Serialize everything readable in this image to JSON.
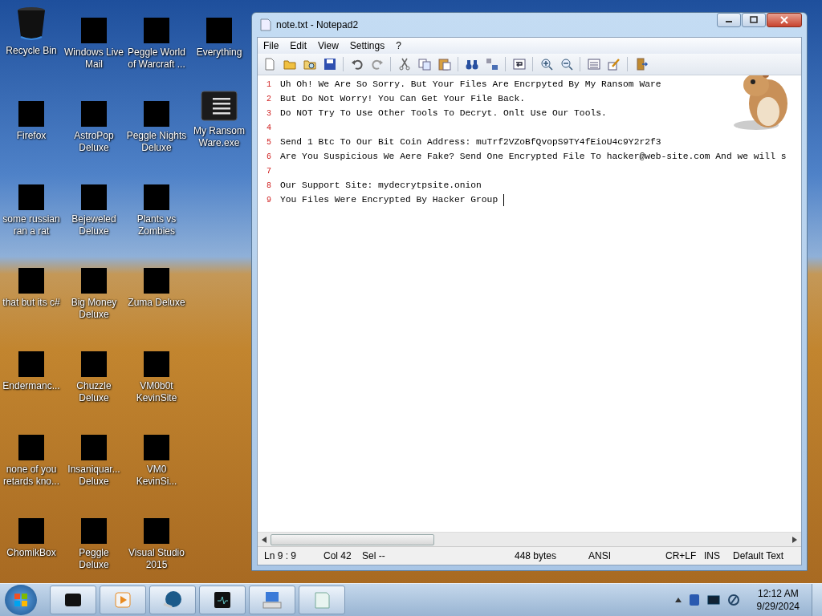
{
  "desktop_icons": [
    {
      "label": "Recycle Bin",
      "kind": "bin"
    },
    {
      "label": "Firefox",
      "kind": "redacted"
    },
    {
      "label": "some russian ran a rat",
      "kind": "redacted"
    },
    {
      "label": "that but its c#",
      "kind": "redacted"
    },
    {
      "label": "Endermanc...",
      "kind": "redacted"
    },
    {
      "label": "none of you retards kno...",
      "kind": "redacted"
    },
    {
      "label": "ChomikBox",
      "kind": "redacted"
    },
    {
      "label": "Windows Live Mail",
      "kind": "redacted"
    },
    {
      "label": "AstroPop Deluxe",
      "kind": "redacted"
    },
    {
      "label": "Bejeweled Deluxe",
      "kind": "redacted"
    },
    {
      "label": "Big Money Deluxe",
      "kind": "redacted"
    },
    {
      "label": "Chuzzle Deluxe",
      "kind": "redacted"
    },
    {
      "label": "Insaniquar... Deluxe",
      "kind": "redacted"
    },
    {
      "label": "Peggle Deluxe",
      "kind": "redacted"
    },
    {
      "label": "Peggle World of Warcraft ...",
      "kind": "redacted"
    },
    {
      "label": "Peggle Nights Deluxe",
      "kind": "redacted"
    },
    {
      "label": "Plants vs Zombies",
      "kind": "redacted"
    },
    {
      "label": "Zuma Deluxe",
      "kind": "redacted"
    },
    {
      "label": "VM0b0t KevinSite",
      "kind": "redacted"
    },
    {
      "label": "VM0 KevinSi...",
      "kind": "redacted"
    },
    {
      "label": "Visual Studio 2015",
      "kind": "redacted"
    },
    {
      "label": "Everything",
      "kind": "redacted"
    },
    {
      "label": "My Ransom Ware.exe",
      "kind": "window"
    }
  ],
  "window": {
    "title": "note.txt - Notepad2",
    "menu": [
      "File",
      "Edit",
      "View",
      "Settings",
      "?"
    ],
    "lines": [
      {
        "number": "1",
        "text": "Uh Oh! We Are So Sorry. But Your Files Are Encrpyted By My Ransom Ware"
      },
      {
        "number": "2",
        "text": "But Do Not Worry! You Can Get Your File Back."
      },
      {
        "number": "3",
        "text": "Do NOT Try To Use Other Tools To Decryt. Onlt Use Our Tools."
      },
      {
        "number": "4"
      },
      {
        "number": "5",
        "text": "Send 1 Btc To Our Bit Coin Address: muTrf2VZoBfQvopS9TY4fEioU4c9Y2r2f3"
      },
      {
        "number": "6",
        "text": "Are You Suspicious We Aere Fake? Send One Encrypted File To hacker@web-site.com And we will s"
      },
      {
        "number": "7"
      },
      {
        "number": "8",
        "text": "Our Support Site: mydecrytpsite.onion"
      },
      {
        "number": "9",
        "text": "You Files Were Encrypted By Hacker Group "
      }
    ],
    "status_bar": [
      "Ln 9 : 9",
      "Col 42",
      "Sel --",
      "448 bytes",
      "ANSI",
      "CR+LF",
      "INS",
      "Default Text"
    ]
  },
  "taskbar": {
    "clock_time": "12:12 AM",
    "clock_date": "9/29/2024"
  }
}
